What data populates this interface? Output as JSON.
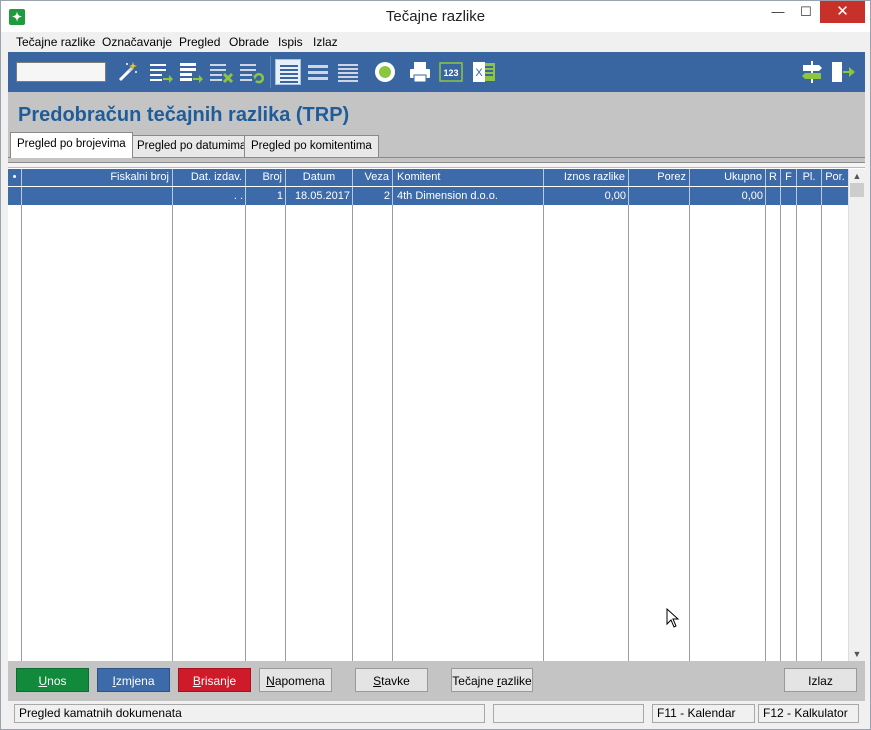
{
  "window": {
    "title": "Tečajne razlike",
    "app_icon": "✦",
    "minimize": "—",
    "maximize": "☐",
    "close": "✕"
  },
  "menu": {
    "items": [
      "Tečajne razlike",
      "Označavanje",
      "Pregled",
      "Obrade",
      "Ispis",
      "Izlaz"
    ]
  },
  "toolbar": {
    "search_value": "",
    "icons": [
      "magic-wand-icon",
      "list-add-icon",
      "list-add-bold-icon",
      "list-delete-icon",
      "list-refresh-icon",
      "view-list-selected-icon",
      "view-list-icon",
      "view-list-dense-icon",
      "record-circle-icon",
      "printer-icon",
      "numbers-123-icon",
      "excel-icon",
      "signpost-icon",
      "exit-door-icon"
    ],
    "accent_color": "#3966a0",
    "icon_label_123": "123",
    "icon_label_excel": "X"
  },
  "page": {
    "title": "Predobračun tečajnih razlika (TRP)"
  },
  "tabs": [
    {
      "label": "Pregled po brojevima",
      "active": true
    },
    {
      "label": "Pregled po datumima",
      "active": false
    },
    {
      "label": "Pregled po komitentima",
      "active": false
    }
  ],
  "grid": {
    "columns": [
      "•",
      "Fiskalni broj",
      "Dat. izdav.",
      "Broj",
      "Datum",
      "Veza",
      "Komitent",
      "Iznos razlike",
      "Porez",
      "Ukupno",
      "R",
      "F",
      "Pl.",
      "Por."
    ],
    "rows": [
      {
        "marker": "",
        "fiskalni_broj": "",
        "dat_izdav": ". .",
        "broj": "1",
        "datum": "18.05.2017",
        "veza": "2",
        "komitent": "4th Dimension d.o.o.",
        "iznos_razlike": "0,00",
        "porez": "",
        "ukupno": "0,00",
        "r": "",
        "f": "",
        "pl": "",
        "por": ""
      }
    ],
    "scroll_up": "▲",
    "scroll_down": "▼"
  },
  "buttons": {
    "unos": {
      "hot": "U",
      "rest": "nos"
    },
    "izmjena": {
      "hot": "I",
      "rest": "zmjena"
    },
    "brisanje": {
      "hot": "B",
      "rest": "risanje"
    },
    "napomena": {
      "hot": "N",
      "rest": "apomena"
    },
    "stavke": {
      "hot": "S",
      "rest": "tavke"
    },
    "tecajne_pre": "Tečajne ",
    "tecajne_hot": "r",
    "tecajne_post": "azlike",
    "izlaz": "Izlaz",
    "colors": {
      "unos": "#128a3c",
      "izmjena": "#3d6aa8",
      "brisanje": "#cf1a2a"
    }
  },
  "status": {
    "message": "Pregled kamatnih dokumenata",
    "panel2": "",
    "f11": "F11 - Kalendar",
    "f12": "F12 - Kalkulator"
  }
}
